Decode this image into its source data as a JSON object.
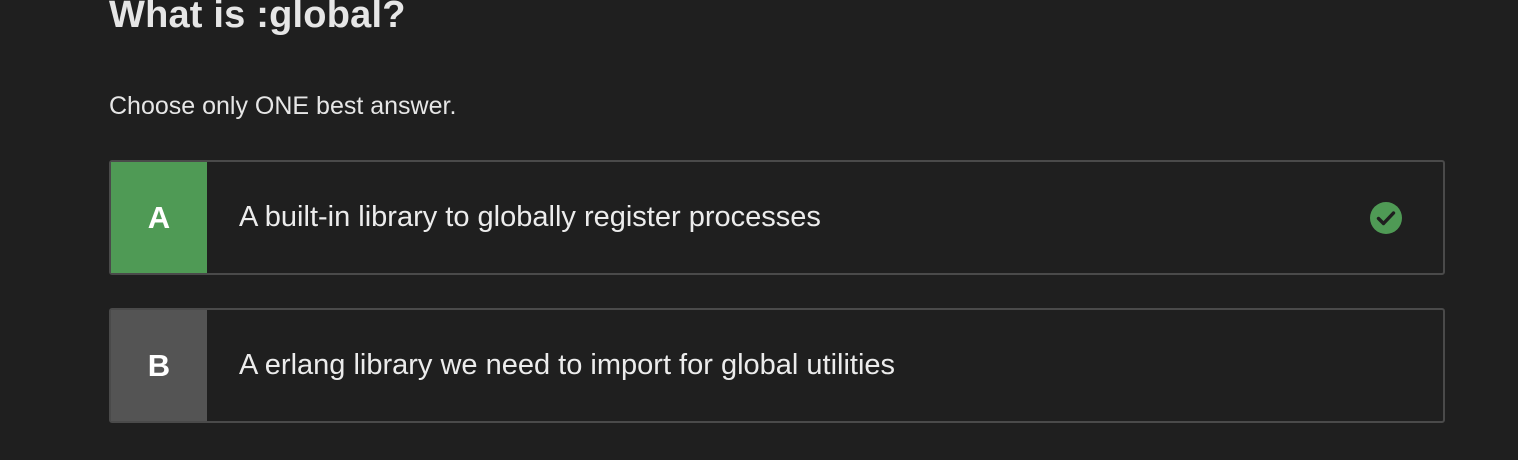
{
  "question": {
    "title": "What is :global?",
    "instruction": "Choose only ONE best answer."
  },
  "options": [
    {
      "letter": "A",
      "text": "A built-in library to globally register processes",
      "selected": true,
      "correct_icon": "check-circle-icon",
      "color": "#4f9a55"
    },
    {
      "letter": "B",
      "text": "A erlang library we need to import for global utilities",
      "selected": false,
      "color": "#545454"
    }
  ],
  "colors": {
    "background": "#1f1f1f",
    "correct": "#4f9a55",
    "neutral": "#545454",
    "border": "#4a4a4a"
  }
}
